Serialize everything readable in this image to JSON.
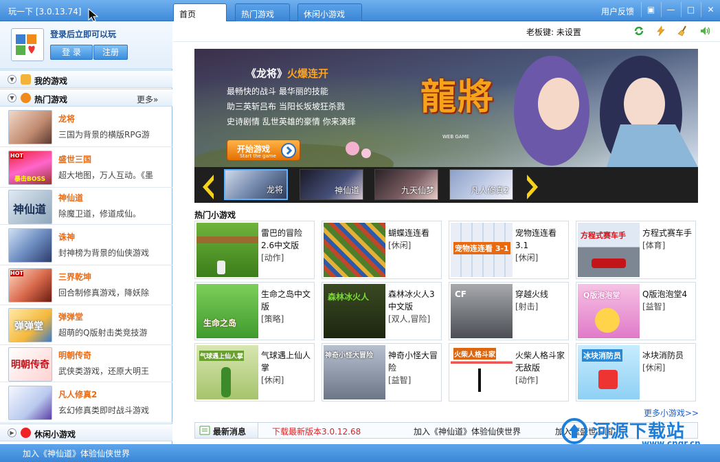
{
  "window": {
    "title": "玩一下 [3.0.13.74]",
    "tabs": [
      "首页",
      "热门游戏",
      "休闲小游戏"
    ],
    "feedback": "用户反馈",
    "controls": [
      "restore-icon",
      "minimize-icon",
      "maximize-icon",
      "close-icon"
    ]
  },
  "login": {
    "prompt": "登录后立即可以玩",
    "login_button": "登 录",
    "register_button": "注册"
  },
  "sidebar": {
    "my_games": "我的游戏",
    "hot_games": "热门游戏",
    "more": "更多»",
    "casual_games": "休闲小游戏",
    "games": [
      {
        "name": "龙将",
        "desc": "三国为背景的横版RPG游"
      },
      {
        "name": "盛世三国",
        "desc": "超大地图，万人互动。《墨"
      },
      {
        "name": "神仙道",
        "desc": "除魔卫道，修道成仙。"
      },
      {
        "name": "诛神",
        "desc": "封神榜为背景的仙侠游戏"
      },
      {
        "name": "三界乾坤",
        "desc": "回合制修真游戏，降妖除"
      },
      {
        "name": "弹弹堂",
        "desc": "超萌的Q版射击类竞技游"
      },
      {
        "name": "明朝传奇",
        "desc": "武侠类游戏，还原大明王"
      },
      {
        "name": "凡人修真2",
        "desc": "玄幻修真类即时战斗游戏"
      }
    ],
    "thumb_texts": {
      "thumb2_top": "HOT",
      "thumb2_bottom": "暴击BOSS",
      "thumb3": "神仙道",
      "thumb5_top": "HOT",
      "thumb6": "弹弹堂",
      "thumb7": "明朝传奇"
    }
  },
  "toolbar": {
    "boss_key": "老板键: 未设置",
    "icons": [
      "refresh-icon",
      "lightning-icon",
      "broom-icon",
      "speaker-icon"
    ]
  },
  "banner": {
    "title_prefix": "《龙将》",
    "title_suffix": "火爆连开",
    "lines": [
      "最畅快的战斗 最华丽的技能",
      "助三英斩吕布 当阳长坂坡狂杀戮",
      "史诗剧情 乱世英雄的豪情 你来演绎"
    ],
    "start_button": "开始游戏",
    "start_button_sub": "Start the game",
    "logo_text": "龍將",
    "logo_sub": "WEB GAME"
  },
  "carousel": {
    "items": [
      "龙将",
      "神仙道",
      "九天仙梦",
      "凡人修真2"
    ]
  },
  "mini_games": {
    "heading": "热门小游戏",
    "items": [
      {
        "name": "雷巴的冒险2.6中文版",
        "tag": "[动作]",
        "img_text": ""
      },
      {
        "name": "蝴蝶连连看",
        "tag": "[休闲]",
        "img_text": ""
      },
      {
        "name": "宠物连连看3.1",
        "tag": "[休闲]",
        "img_text": "宠物连连看 3-1"
      },
      {
        "name": "方程式赛车手",
        "tag": "[体育]",
        "img_text": "方程式赛车手"
      },
      {
        "name": "生命之岛中文版",
        "tag": "[策略]",
        "img_text": "生命之岛"
      },
      {
        "name": "森林冰火人3中文版",
        "tag": "[双人,冒险]",
        "img_text": "森林冰火人"
      },
      {
        "name": "穿越火线",
        "tag": "[射击]",
        "img_text": "CF"
      },
      {
        "name": "Q版泡泡堂4",
        "tag": "[益智]",
        "img_text": "Q版泡泡堂"
      },
      {
        "name": "气球遇上仙人掌",
        "tag": "[休闲]",
        "img_text": "气球遇上仙人掌"
      },
      {
        "name": "神奇小怪大冒险",
        "tag": "[益智]",
        "img_text": "神奇小怪大冒险"
      },
      {
        "name": "火柴人格斗家无敌版",
        "tag": "[动作]",
        "img_text": "火柴人格斗家"
      },
      {
        "name": "冰块消防员",
        "tag": "[休闲]",
        "img_text": "冰块消防员"
      }
    ],
    "more_link": "更多小游戏>>"
  },
  "news": {
    "label": "最新消息",
    "items": [
      "下载最新版本3.0.12.68",
      "加入《神仙道》体验仙侠世界",
      "加入《盛世三国"
    ]
  },
  "status": {
    "text": "加入《神仙道》体验仙侠世界"
  },
  "watermark": {
    "text": "河源下载站",
    "url": "www.cngr.cn"
  },
  "colors": {
    "accent_blue": "#3f8ad9",
    "game_name_orange": "#ec6a12",
    "news_red": "#e02020",
    "link_blue": "#1a5fc8"
  }
}
